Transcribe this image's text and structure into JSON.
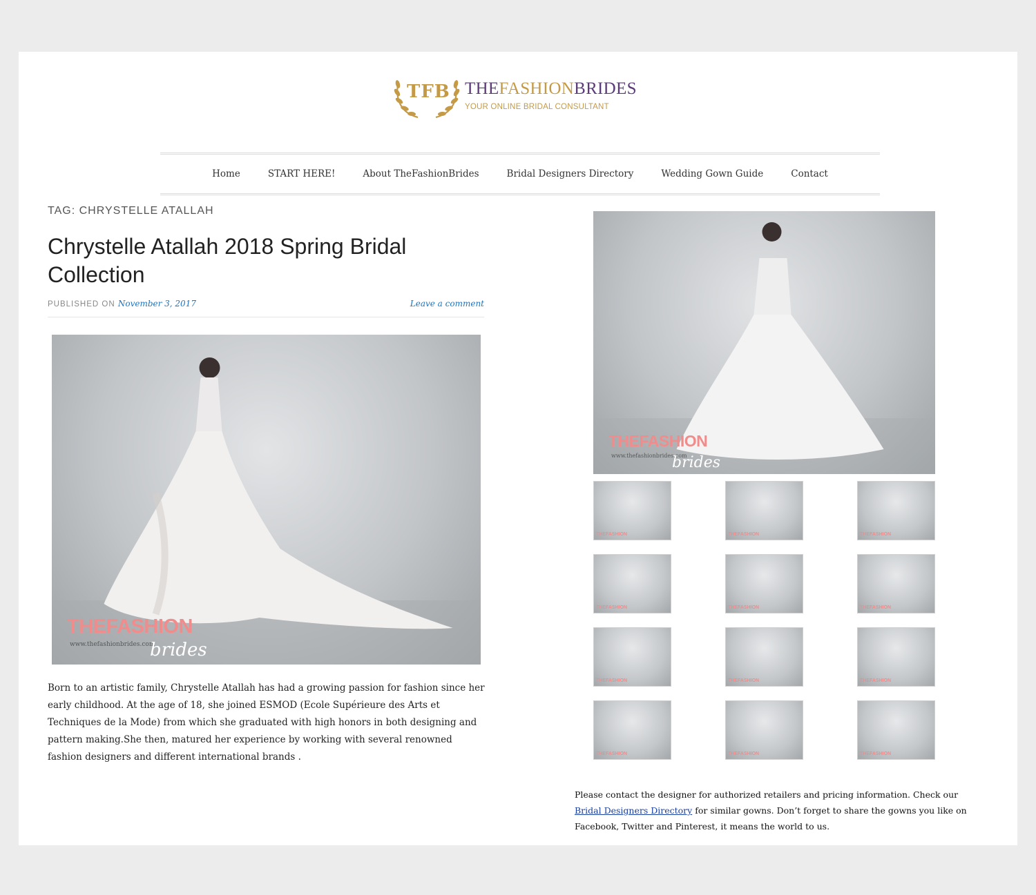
{
  "logo": {
    "monogram": "TFB",
    "brand_part1": "THE",
    "brand_part2": "FASHION",
    "brand_part3": "BRIDES",
    "tagline": "YOUR ONLINE BRIDAL CONSULTANT"
  },
  "nav": {
    "items": [
      "Home",
      "START HERE!",
      "About TheFashionBrides",
      "Bridal Designers Directory",
      "Wedding Gown Guide",
      "Contact"
    ]
  },
  "post": {
    "tag_label": "TAG: CHRYSTELLE ATALLAH",
    "title": "Chrystelle Atallah 2018 Spring Bridal Collection",
    "published_label": "PUBLISHED ON",
    "date": "November 3, 2017",
    "comment_link": "Leave a comment",
    "body": "Born to an artistic family, Chrystelle Atallah has had a growing passion for fashion since her early childhood.  At the age of 18, she joined ESMOD (Ecole Supérieure des Arts et Techniques de la Mode) from which she graduated with high honors in both designing and pattern making.She then, matured her experience by working with several renowned fashion designers and different international brands ."
  },
  "watermark": {
    "brand": "THEFASHION",
    "url": "www.thefashionbrides.com",
    "script": "brides"
  },
  "sidebar": {
    "contact_text_1": "Please contact the designer for authorized retailers and pricing information.  Check our ",
    "contact_link": "Bridal Designers Directory",
    "contact_text_2": " for similar gowns. Don’t forget to share the gowns you like on Facebook, Twitter and Pinterest, it means the world to us."
  }
}
